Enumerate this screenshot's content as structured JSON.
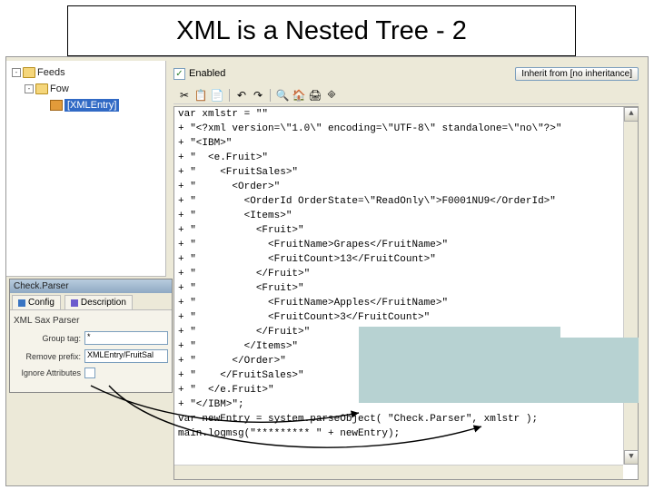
{
  "slide": {
    "title": "XML is a Nested Tree - 2"
  },
  "tree": {
    "items": [
      {
        "label": "Feeds",
        "expander": "-"
      },
      {
        "label": "Fow",
        "expander": "-"
      },
      {
        "label": "[XMLEntry]"
      }
    ]
  },
  "header": {
    "enabled_label": "Enabled",
    "enabled_check": "✓",
    "inherit_label": "Inherit from [no inheritance]"
  },
  "toolbar": {
    "icons": [
      "✂",
      "📋",
      "📄",
      "|",
      "↶",
      "↷",
      "|",
      "🔍",
      "🏠",
      "🖨",
      "🞜"
    ]
  },
  "code": {
    "lines": [
      "var xmlstr = \"\"",
      "+ \"<?xml version=\\\"1.0\\\" encoding=\\\"UTF-8\\\" standalone=\\\"no\\\"?>\"",
      "+ \"<IBM>\"",
      "+ \"  <e.Fruit>\"",
      "+ \"    <FruitSales>\"",
      "+ \"      <Order>\"",
      "+ \"        <OrderId OrderState=\\\"ReadOnly\\\">F0001NU9</OrderId>\"",
      "+ \"        <Items>\"",
      "+ \"          <Fruit>\"",
      "+ \"            <FruitName>Grapes</FruitName>\"",
      "+ \"            <FruitCount>13</FruitCount>\"",
      "+ \"          </Fruit>\"",
      "+ \"          <Fruit>\"",
      "+ \"            <FruitName>Apples</FruitName>\"",
      "+ \"            <FruitCount>3</FruitCount>\"",
      "+ \"          </Fruit>\"",
      "+ \"        </Items>\"",
      "+ \"      </Order>\"",
      "+ \"    </FruitSales>\"",
      "+ \"  </e.Fruit>\"",
      "+ \"</IBM>\";",
      "",
      "var newEntry = system.parseObject( \"Check.Parser\", xmlstr );",
      "",
      "main.logmsg(\"********* \" + newEntry);"
    ]
  },
  "dialog": {
    "title": "Check.Parser",
    "tabs": {
      "t0": "Config",
      "t1": "Description"
    },
    "section": "XML Sax Parser",
    "rows": {
      "group_label": "Group tag:",
      "group_value": "*",
      "remove_label": "Remove prefix:",
      "remove_value": "XMLEntry/FruitSal",
      "ignore_label": "Ignore Attributes"
    }
  }
}
